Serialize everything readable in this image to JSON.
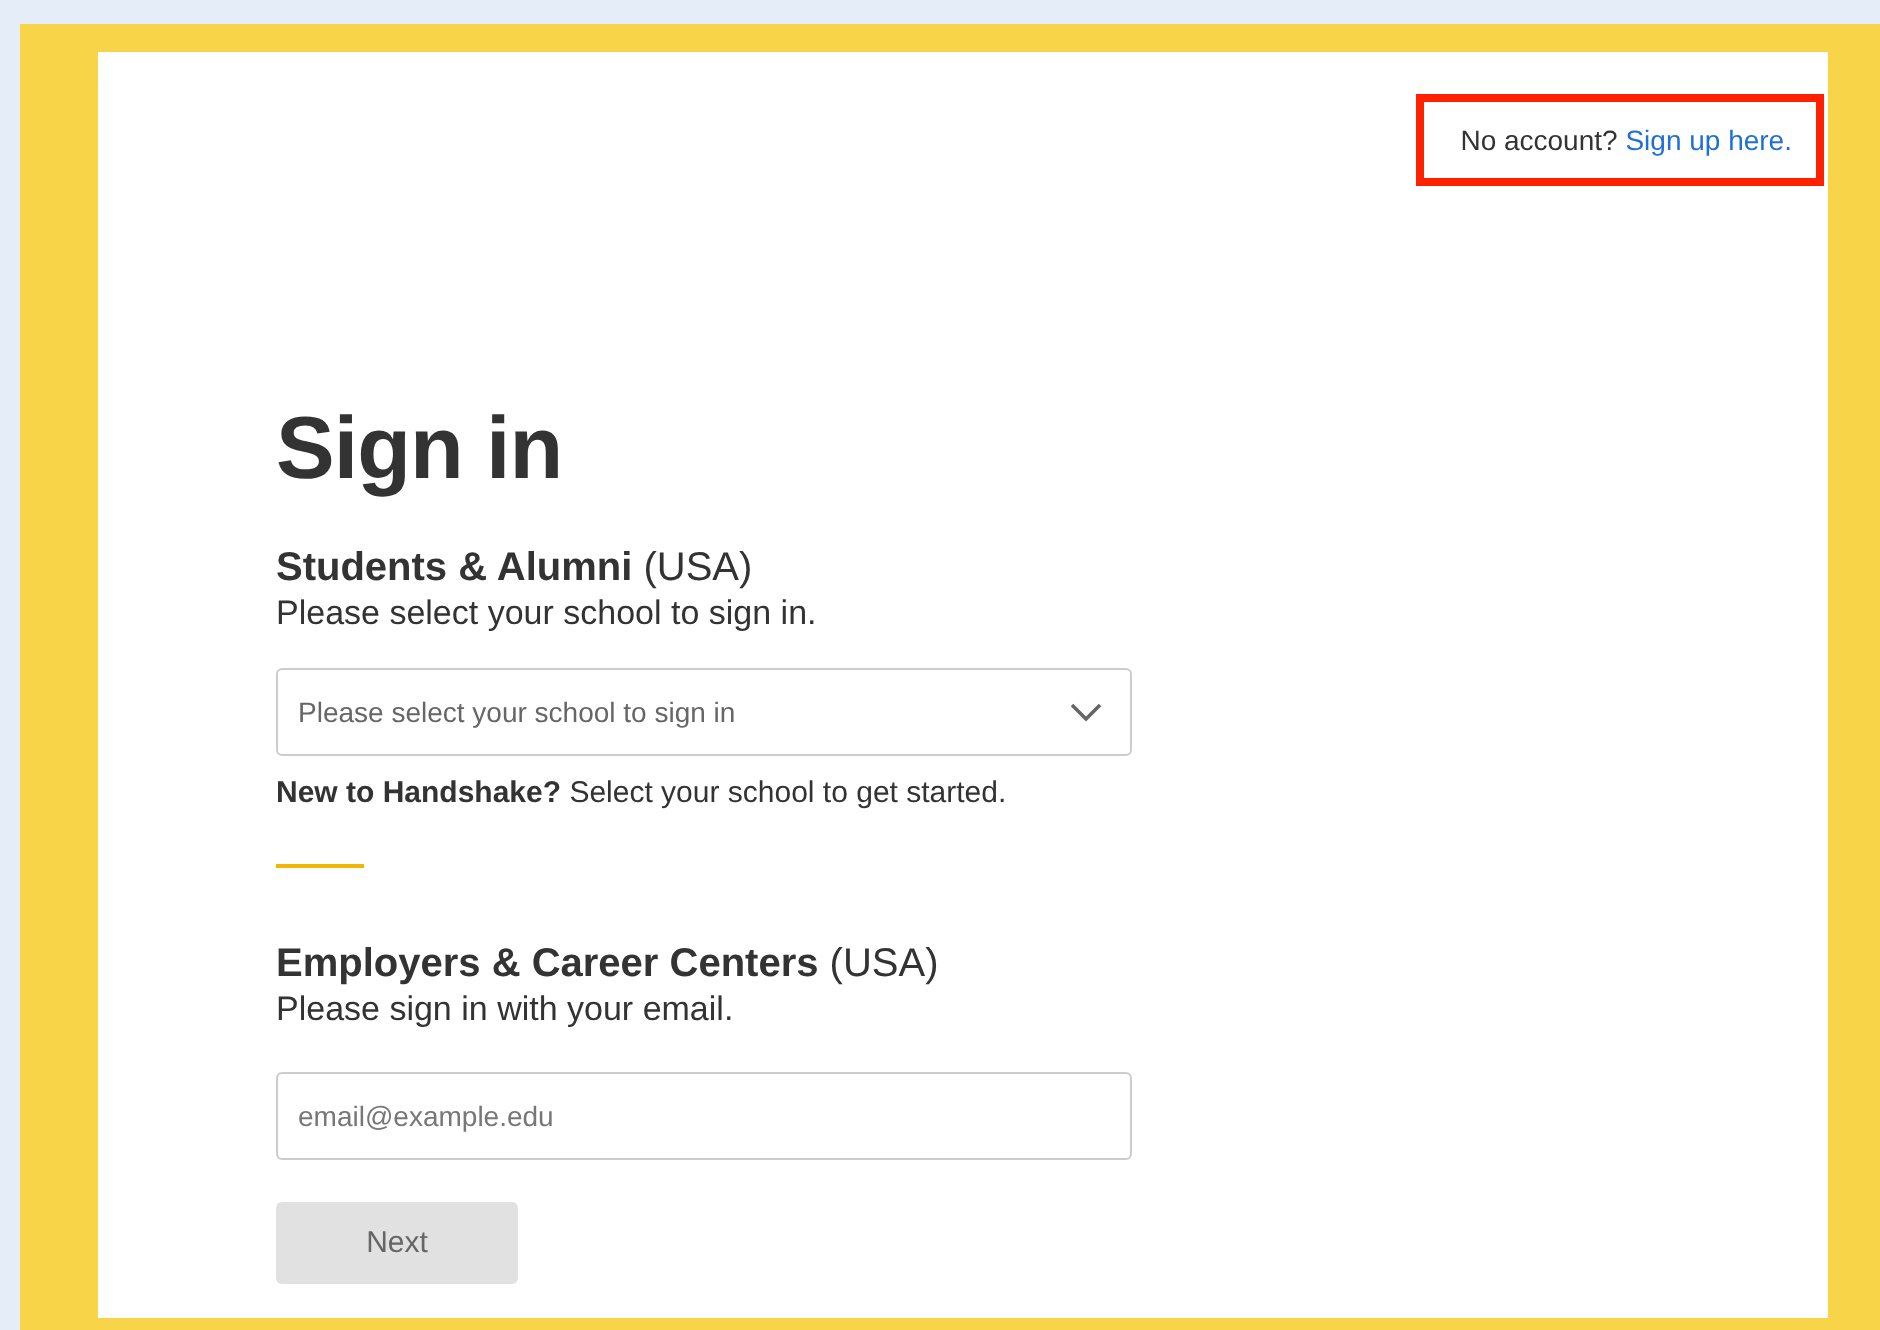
{
  "signup_prompt": {
    "text": "No account?",
    "link": "Sign up here.",
    "highlighted": true
  },
  "title": "Sign in",
  "students": {
    "heading": "**Students & Alumni** (USA)",
    "subtitle": "Please select your school to sign in.",
    "dropdown": {
      "placeholder": "Please select your school to sign in"
    },
    "note": "**New to Handshake?** Select your school to get started."
  },
  "employers": {
    "heading": "**Employers & Career Centers** (USA)",
    "subtitle": "Please sign in with your email.",
    "email": {
      "placeholder": "email@example.edu"
    },
    "next_button": {
      "label": "Next",
      "disabled": true
    }
  }
}
